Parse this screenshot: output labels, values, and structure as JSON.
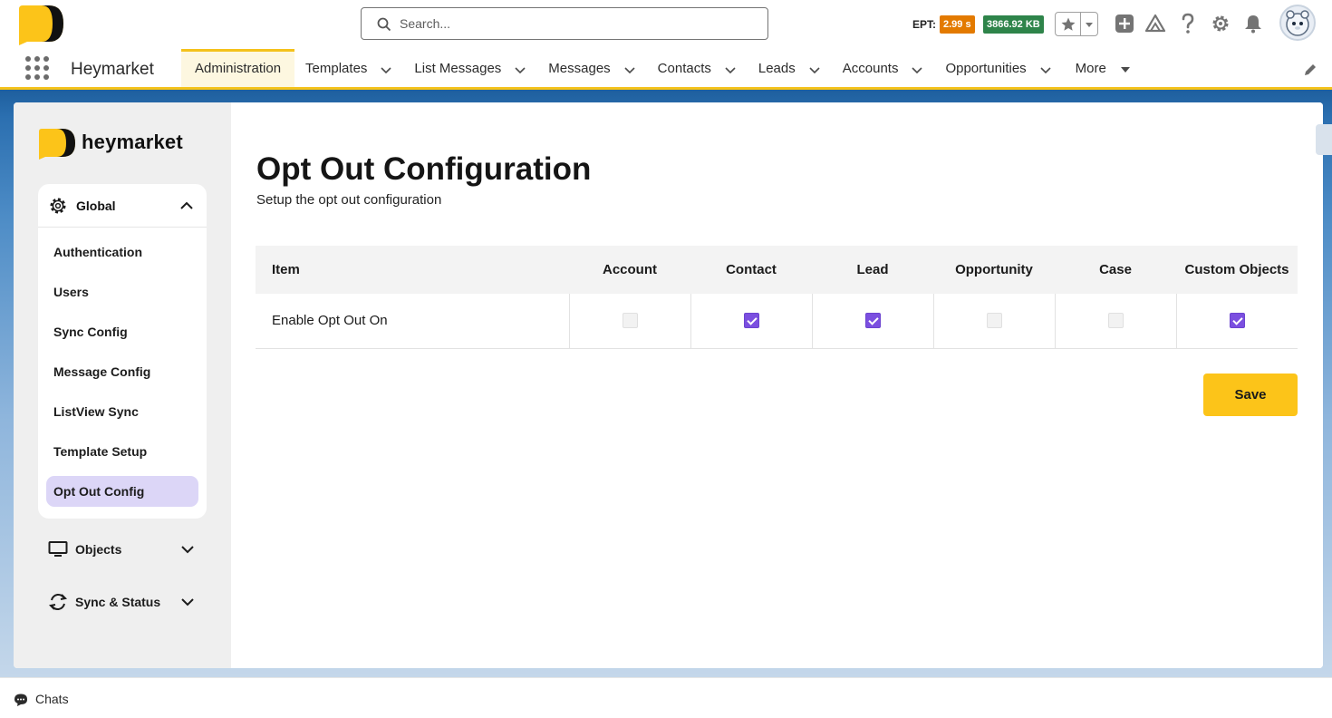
{
  "header": {
    "search_placeholder": "Search...",
    "ept_label": "EPT:",
    "ept_value": "2.99 s",
    "page_size": "3866.92 KB",
    "icons": [
      "star-icon",
      "chevron-down-icon",
      "add-icon",
      "trailhead-icon",
      "help-icon",
      "setup-gear-icon",
      "bell-icon",
      "avatar"
    ]
  },
  "nav": {
    "app_name": "Heymarket",
    "items": [
      {
        "label": "Administration",
        "active": true,
        "has_menu": false
      },
      {
        "label": "Templates",
        "active": false,
        "has_menu": true
      },
      {
        "label": "List Messages",
        "active": false,
        "has_menu": true
      },
      {
        "label": "Messages",
        "active": false,
        "has_menu": true
      },
      {
        "label": "Contacts",
        "active": false,
        "has_menu": true
      },
      {
        "label": "Leads",
        "active": false,
        "has_menu": true
      },
      {
        "label": "Accounts",
        "active": false,
        "has_menu": true
      },
      {
        "label": "Opportunities",
        "active": false,
        "has_menu": true
      },
      {
        "label": "More",
        "active": false,
        "has_menu": true
      }
    ]
  },
  "sidebar": {
    "brand": "heymarket",
    "global_label": "Global",
    "menu_items": [
      {
        "label": "Authentication",
        "selected": false
      },
      {
        "label": "Users",
        "selected": false
      },
      {
        "label": "Sync Config",
        "selected": false
      },
      {
        "label": "Message Config",
        "selected": false
      },
      {
        "label": "ListView Sync",
        "selected": false
      },
      {
        "label": "Template Setup",
        "selected": false
      },
      {
        "label": "Opt Out Config",
        "selected": true
      }
    ],
    "objects_label": "Objects",
    "sync_label": "Sync & Status"
  },
  "main": {
    "title": "Opt Out Configuration",
    "subtitle": "Setup the opt out configuration",
    "table": {
      "columns": [
        "Item",
        "Account",
        "Contact",
        "Lead",
        "Opportunity",
        "Case",
        "Custom Objects"
      ],
      "rows": [
        {
          "item": "Enable Opt Out On",
          "values": [
            false,
            true,
            true,
            false,
            false,
            true
          ]
        }
      ]
    },
    "save_label": "Save"
  },
  "utility": {
    "chats_label": "Chats"
  },
  "colors": {
    "accent_yellow": "#f4c21b",
    "checkbox_checked": "#7b4fe0",
    "selected_menu": "#dcd6f7",
    "ept_badge": "#e37a00",
    "kb_badge": "#2e844a"
  }
}
